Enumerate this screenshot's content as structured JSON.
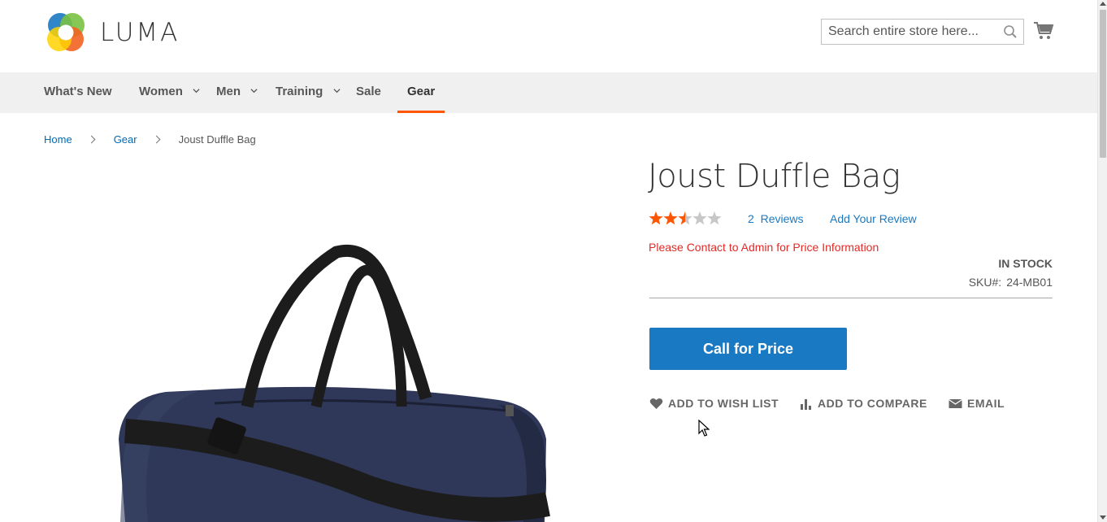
{
  "header": {
    "logo_text": "LUMA",
    "search_placeholder": "Search entire store here...",
    "icons": [
      "search-icon",
      "cart-icon"
    ]
  },
  "nav": {
    "items": [
      {
        "label": "What's New",
        "has_dropdown": false
      },
      {
        "label": "Women",
        "has_dropdown": true
      },
      {
        "label": "Men",
        "has_dropdown": true
      },
      {
        "label": "Training",
        "has_dropdown": true
      },
      {
        "label": "Sale",
        "has_dropdown": false
      },
      {
        "label": "Gear",
        "has_dropdown": false,
        "active": true
      }
    ]
  },
  "breadcrumbs": {
    "home": "Home",
    "gear": "Gear",
    "current": "Joust Duffle Bag"
  },
  "product": {
    "title": "Joust Duffle Bag",
    "rating_stars": 2.5,
    "rating_max": 5,
    "reviews_count": "2",
    "reviews_label": "Reviews",
    "add_review": "Add Your Review",
    "price_message": "Please Contact to Admin for Price Information",
    "stock": "IN STOCK",
    "sku_label": "SKU#:",
    "sku_value": "24-MB01",
    "call_button": "Call for Price",
    "actions": {
      "wishlist": "ADD TO WISH LIST",
      "compare": "ADD TO COMPARE",
      "email": "EMAIL"
    }
  },
  "colors": {
    "accent_link": "#006bb4",
    "button_blue": "#1979c3",
    "nav_active_orange": "#ff5501",
    "price_message_red": "#e02b27",
    "star_filled": "#ff5501",
    "star_empty": "#c7c7c7"
  }
}
